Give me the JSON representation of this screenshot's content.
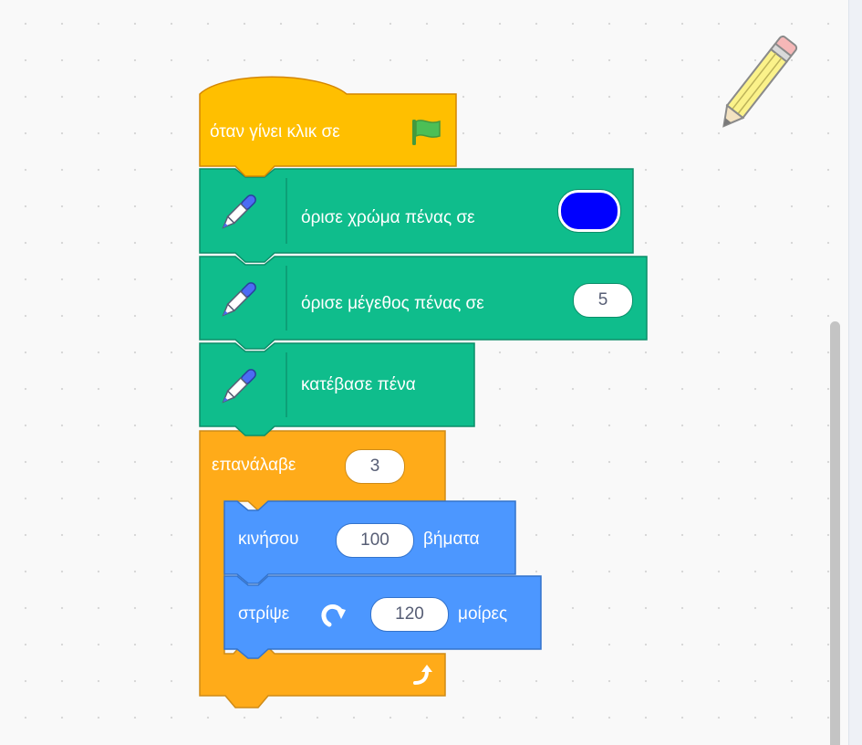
{
  "blocks": {
    "when_flag": {
      "label": "όταν γίνει κλικ σε",
      "icon": "green-flag-icon"
    },
    "set_pen_color": {
      "label": "όρισε χρώμα πένας σε",
      "color_value": "#0000ff",
      "icon": "pen-icon"
    },
    "set_pen_size": {
      "label": "όρισε μέγεθος πένας σε",
      "value": "5",
      "icon": "pen-icon"
    },
    "pen_down": {
      "label": "κατέβασε πένα",
      "icon": "pen-icon"
    },
    "repeat": {
      "label": "επανάλαβε",
      "value": "3",
      "end_icon": "loop-arrow-icon"
    },
    "move": {
      "label": "κινήσου",
      "value": "100",
      "suffix": "βήματα"
    },
    "turn": {
      "label": "στρίψε",
      "value": "120",
      "suffix": "μοίρες",
      "icon": "rotate-right-icon"
    }
  },
  "colors": {
    "events": "#ffbf00",
    "pen": "#0fbd8c",
    "control": "#ffab19",
    "motion": "#4c97ff",
    "workspace": "#f9f9f9"
  },
  "overlay": {
    "icon": "pencil-icon"
  }
}
